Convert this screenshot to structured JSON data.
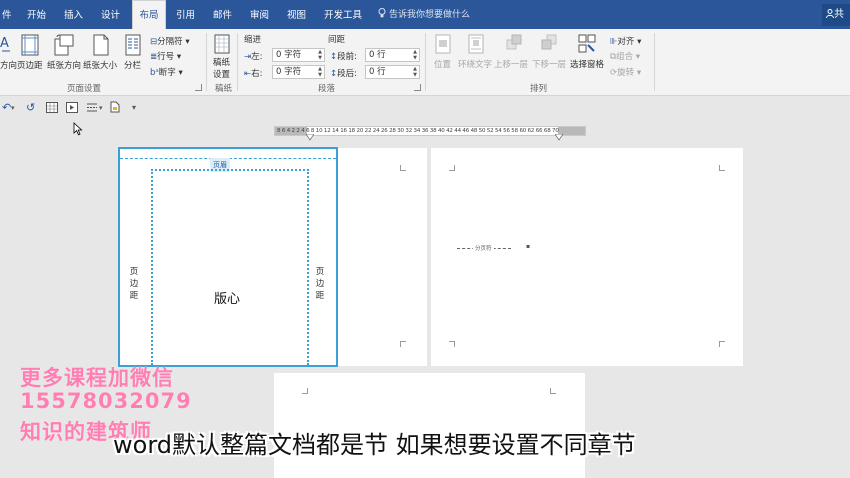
{
  "menubar": {
    "tabs": [
      {
        "label": "件",
        "active": false
      },
      {
        "label": "开始",
        "active": false
      },
      {
        "label": "插入",
        "active": false
      },
      {
        "label": "设计",
        "active": false
      },
      {
        "label": "布局",
        "active": true
      },
      {
        "label": "引用",
        "active": false
      },
      {
        "label": "邮件",
        "active": false
      },
      {
        "label": "审阅",
        "active": false
      },
      {
        "label": "视图",
        "active": false
      },
      {
        "label": "开发工具",
        "active": false
      }
    ],
    "tell_me": "告诉我你想要做什么",
    "share": "共"
  },
  "ribbon": {
    "page_setup": {
      "buttons": [
        "方向",
        "页边距",
        "纸张方向",
        "纸张大小",
        "分栏"
      ],
      "small": [
        "分隔符",
        "行号",
        "断字"
      ],
      "label": "页面设置"
    },
    "draft": {
      "button_line1": "稿纸",
      "button_line2": "设置",
      "label": "稿纸"
    },
    "paragraph": {
      "indent_title": "缩进",
      "spacing_title": "间距",
      "left_label": "左:",
      "left_value": "0 字符",
      "right_label": "右:",
      "right_value": "0 字符",
      "before_label": "段前:",
      "before_value": "0 行",
      "after_label": "段后:",
      "after_value": "0 行",
      "label": "段落"
    },
    "arrange": {
      "position": "位置",
      "wrap": "环绕文字",
      "forward": "上移一层",
      "backward": "下移一层",
      "selection_pane": "选择窗格",
      "align": "对齐",
      "group": "组合",
      "rotate": "旋转",
      "label": "排列"
    }
  },
  "ruler": {
    "numbers": "8 6 4 2   2  4  6  8 10 12 14 16 18 20 22 24 26 28 30 32 34 36 38 40 42 44 46 48 50 52 54 56 58 60 62    66 68 70"
  },
  "page1": {
    "header_tag": "页眉",
    "left_margin": "页边距",
    "right_margin": "页边距",
    "content_area": "版心"
  },
  "page2": {
    "section_break": "分页符"
  },
  "watermark": {
    "line1": "更多课程加微信",
    "line2": "15578032079",
    "line3": "知识的建筑师"
  },
  "subtitle": "word默认整篇文档都是节  如果想要设置不同章节",
  "colors": {
    "brand": "#2b579a",
    "selection": "#3aa0d5",
    "watermark": "#ff7fb3"
  }
}
